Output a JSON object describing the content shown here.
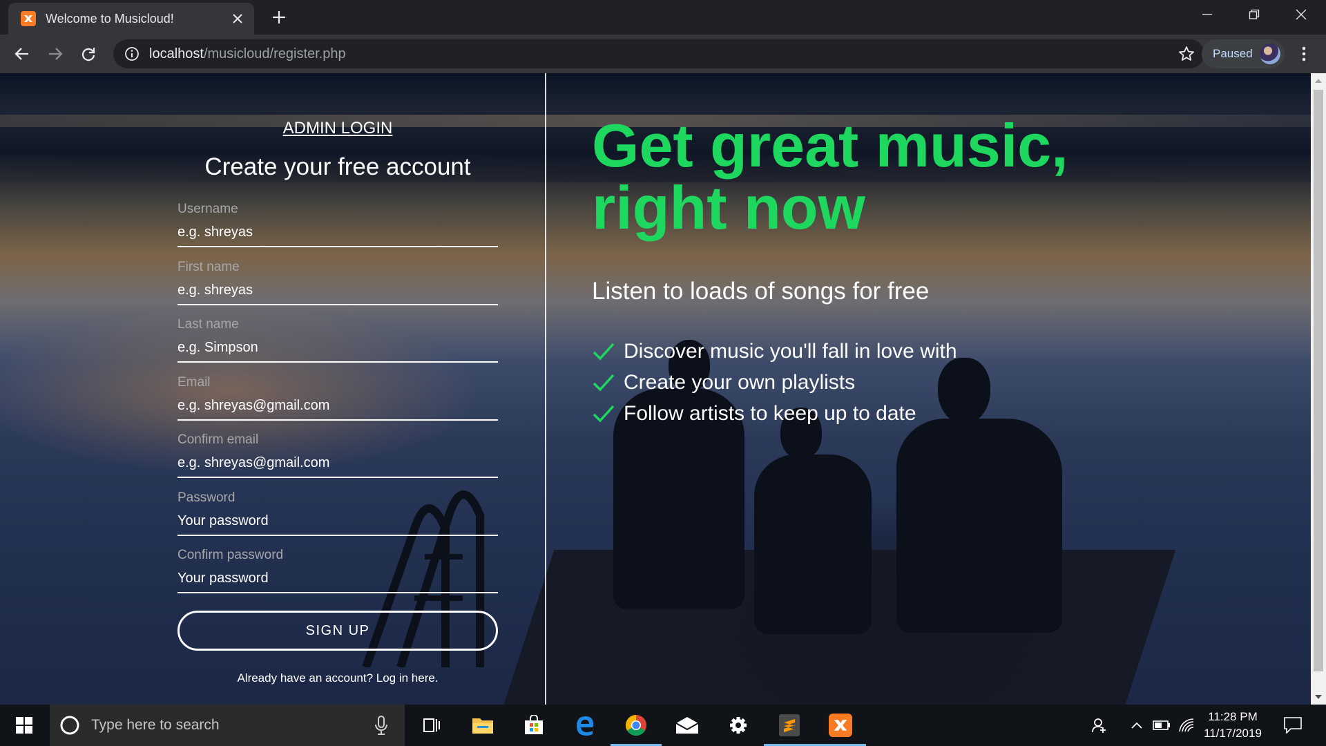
{
  "browser": {
    "tab_title": "Welcome to Musicloud!",
    "url_host": "localhost",
    "url_path": "/musicloud/register.php",
    "profile_status": "Paused"
  },
  "colors": {
    "accent_green": "#1ed75f",
    "favicon_orange": "#fb7a24",
    "taskbar_bg": "#101318"
  },
  "icons": {
    "tab_favicon": "xampp-icon",
    "tab_close": "close-icon",
    "new_tab": "plus-icon",
    "back": "arrow-left-icon",
    "forward": "arrow-right-icon",
    "reload": "reload-icon",
    "site_info": "info-icon",
    "bookmark": "star-icon",
    "menu": "kebab-menu-icon",
    "feature_check": "checkmark-icon"
  },
  "register": {
    "admin_login_label": "ADMIN LOGIN",
    "title": "Create your free account",
    "fields": [
      {
        "label": "Username",
        "placeholder": "e.g. shreyas",
        "type": "text"
      },
      {
        "label": "First name",
        "placeholder": "e.g. shreyas",
        "type": "text"
      },
      {
        "label": "Last name",
        "placeholder": "e.g. Simpson",
        "type": "text"
      },
      {
        "label": "Email",
        "placeholder": "e.g. shreyas@gmail.com",
        "type": "email"
      },
      {
        "label": "Confirm email",
        "placeholder": "e.g. shreyas@gmail.com",
        "type": "email"
      },
      {
        "label": "Password",
        "placeholder": "Your password",
        "type": "password"
      },
      {
        "label": "Confirm password",
        "placeholder": "Your password",
        "type": "password"
      }
    ],
    "signup_label": "SIGN UP",
    "login_link": "Already have an account? Log in here."
  },
  "promo": {
    "headline": "Get great music, right now",
    "subheadline": "Listen to loads of songs for free",
    "features": [
      "Discover music you'll fall in love with",
      "Create your own playlists",
      "Follow artists to keep up to date"
    ]
  },
  "taskbar": {
    "search_placeholder": "Type here to search",
    "apps": [
      "task-view-icon",
      "file-explorer-icon",
      "microsoft-store-icon",
      "edge-icon",
      "chrome-icon",
      "mail-icon",
      "settings-icon",
      "sublime-text-icon",
      "xampp-icon"
    ],
    "time": "11:28 PM",
    "date": "11/17/2019"
  }
}
